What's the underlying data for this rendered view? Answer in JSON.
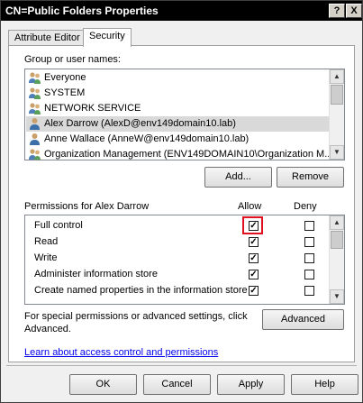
{
  "window": {
    "title": "CN=Public Folders Properties",
    "help_btn": "?",
    "close_btn": "X"
  },
  "tabs": [
    {
      "label": "Attribute Editor",
      "active": false
    },
    {
      "label": "Security",
      "active": true
    }
  ],
  "groups": {
    "label": "Group or user names:",
    "items": [
      {
        "name": "Everyone",
        "icon": "users-group-icon",
        "selected": false
      },
      {
        "name": "SYSTEM",
        "icon": "users-group-icon",
        "selected": false
      },
      {
        "name": "NETWORK SERVICE",
        "icon": "users-group-icon",
        "selected": false
      },
      {
        "name": "Alex Darrow (AlexD@env149domain10.lab)",
        "icon": "user-icon",
        "selected": true
      },
      {
        "name": "Anne Wallace (AnneW@env149domain10.lab)",
        "icon": "user-icon",
        "selected": false
      },
      {
        "name": "Organization Management (ENV149DOMAIN10\\Organization M...",
        "icon": "users-group-icon",
        "selected": false
      }
    ],
    "add_label": "Add...",
    "remove_label": "Remove"
  },
  "permissions": {
    "label": "Permissions for Alex Darrow",
    "allow_header": "Allow",
    "deny_header": "Deny",
    "rows": [
      {
        "name": "Full control",
        "allow": true,
        "deny": false
      },
      {
        "name": "Read",
        "allow": true,
        "deny": false
      },
      {
        "name": "Write",
        "allow": true,
        "deny": false
      },
      {
        "name": "Administer information store",
        "allow": true,
        "deny": false
      },
      {
        "name": "Create named properties in the information store",
        "allow": true,
        "deny": false
      }
    ]
  },
  "advanced": {
    "text_line1": "For special permissions or advanced settings, click",
    "text_line2": "Advanced.",
    "button_label": "Advanced"
  },
  "learn_link": "Learn about access control and permissions",
  "footer": {
    "ok": "OK",
    "cancel": "Cancel",
    "apply": "Apply",
    "help": "Help"
  },
  "colors": {
    "highlight": "#e01020",
    "selected_row": "#d9d9d9",
    "link": "#0000ee"
  }
}
